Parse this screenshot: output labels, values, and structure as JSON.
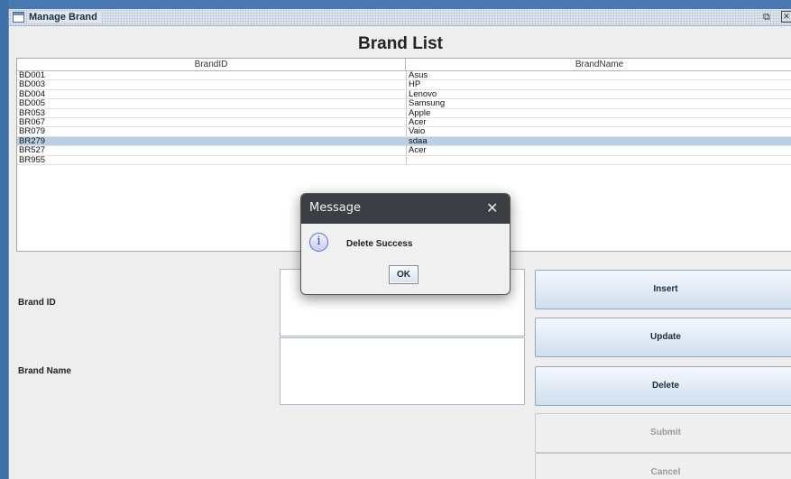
{
  "window": {
    "title": "Manage Brand"
  },
  "list_title": "Brand List",
  "table": {
    "columns": [
      "BrandID",
      "BrandName"
    ],
    "rows": [
      {
        "id": "BD001",
        "name": "Asus"
      },
      {
        "id": "BD003",
        "name": "HP"
      },
      {
        "id": "BD004",
        "name": "Lenovo"
      },
      {
        "id": "BD005",
        "name": "Samsung"
      },
      {
        "id": "BR053",
        "name": "Apple"
      },
      {
        "id": "BR067",
        "name": "Acer"
      },
      {
        "id": "BR079",
        "name": "Vaio"
      },
      {
        "id": "BR279",
        "name": "sdaa"
      },
      {
        "id": "BR527",
        "name": "Acer"
      },
      {
        "id": "BR955",
        "name": ""
      }
    ],
    "selected_row": 7
  },
  "form": {
    "brand_id_label": "Brand ID",
    "brand_name_label": "Brand Name",
    "brand_id_value": "",
    "brand_name_value": ""
  },
  "buttons": {
    "insert": "Insert",
    "update": "Update",
    "delete": "Delete",
    "submit": "Submit",
    "cancel": "Cancel"
  },
  "dialog": {
    "title": "Message",
    "message": "Delete Success",
    "ok": "OK",
    "icon": "info-icon"
  },
  "colors": {
    "selected_row": "#b8cfe5",
    "dialog_title_bar": "#3b3f44",
    "frame_border": "#3d6fa8"
  }
}
